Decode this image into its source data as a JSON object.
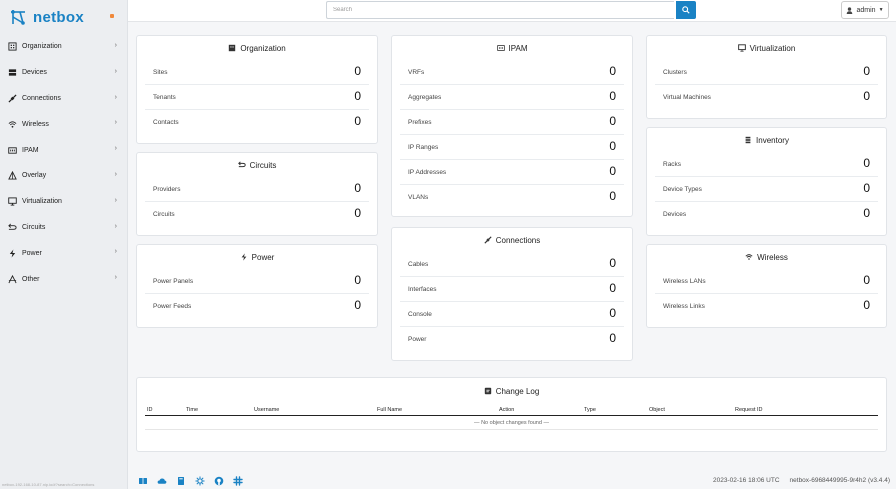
{
  "brand": {
    "name": "netbox"
  },
  "colors": {
    "accent": "#1a82c4",
    "brand_toggle": "#f0883a"
  },
  "sidebar": {
    "items": [
      {
        "label": "Organization",
        "icon": "building-icon"
      },
      {
        "label": "Devices",
        "icon": "server-icon"
      },
      {
        "label": "Connections",
        "icon": "connection-icon"
      },
      {
        "label": "Wireless",
        "icon": "wifi-icon"
      },
      {
        "label": "IPAM",
        "icon": "counter-icon"
      },
      {
        "label": "Overlay",
        "icon": "triangle-icon"
      },
      {
        "label": "Virtualization",
        "icon": "monitor-icon"
      },
      {
        "label": "Circuits",
        "icon": "circuit-icon"
      },
      {
        "label": "Power",
        "icon": "bolt-icon"
      },
      {
        "label": "Other",
        "icon": "other-icon"
      }
    ],
    "status_url": "netbox-192-168-10-87.nip.io/#?search=Connections"
  },
  "topbar": {
    "search_placeholder": "Search",
    "user_label": "admin"
  },
  "cards": {
    "organization": {
      "title": "Organization",
      "rows": [
        {
          "label": "Sites",
          "value": "0"
        },
        {
          "label": "Tenants",
          "value": "0"
        },
        {
          "label": "Contacts",
          "value": "0"
        }
      ]
    },
    "circuits": {
      "title": "Circuits",
      "rows": [
        {
          "label": "Providers",
          "value": "0"
        },
        {
          "label": "Circuits",
          "value": "0"
        }
      ]
    },
    "power": {
      "title": "Power",
      "rows": [
        {
          "label": "Power Panels",
          "value": "0"
        },
        {
          "label": "Power Feeds",
          "value": "0"
        }
      ]
    },
    "ipam": {
      "title": "IPAM",
      "rows": [
        {
          "label": "VRFs",
          "value": "0"
        },
        {
          "label": "Aggregates",
          "value": "0"
        },
        {
          "label": "Prefixes",
          "value": "0"
        },
        {
          "label": "IP Ranges",
          "value": "0"
        },
        {
          "label": "IP Addresses",
          "value": "0"
        },
        {
          "label": "VLANs",
          "value": "0"
        }
      ]
    },
    "connections": {
      "title": "Connections",
      "rows": [
        {
          "label": "Cables",
          "value": "0"
        },
        {
          "label": "Interfaces",
          "value": "0"
        },
        {
          "label": "Console",
          "value": "0"
        },
        {
          "label": "Power",
          "value": "0"
        }
      ]
    },
    "virtualization": {
      "title": "Virtualization",
      "rows": [
        {
          "label": "Clusters",
          "value": "0"
        },
        {
          "label": "Virtual Machines",
          "value": "0"
        }
      ]
    },
    "inventory": {
      "title": "Inventory",
      "rows": [
        {
          "label": "Racks",
          "value": "0"
        },
        {
          "label": "Device Types",
          "value": "0"
        },
        {
          "label": "Devices",
          "value": "0"
        }
      ]
    },
    "wireless": {
      "title": "Wireless",
      "rows": [
        {
          "label": "Wireless LANs",
          "value": "0"
        },
        {
          "label": "Wireless Links",
          "value": "0"
        }
      ]
    }
  },
  "changelog": {
    "title": "Change Log",
    "columns": [
      "ID",
      "Time",
      "Username",
      "Full Name",
      "Action",
      "Type",
      "Object",
      "Request ID"
    ],
    "empty_message": "— No object changes found —"
  },
  "footer": {
    "icons": [
      "docs-icon",
      "cloud-icon",
      "book-icon",
      "api-icon",
      "github-icon",
      "slack-icon"
    ],
    "timestamp": "2023-02-16 18:06 UTC",
    "version": "netbox-6968449995-9r4h2 (v3.4.4)"
  }
}
